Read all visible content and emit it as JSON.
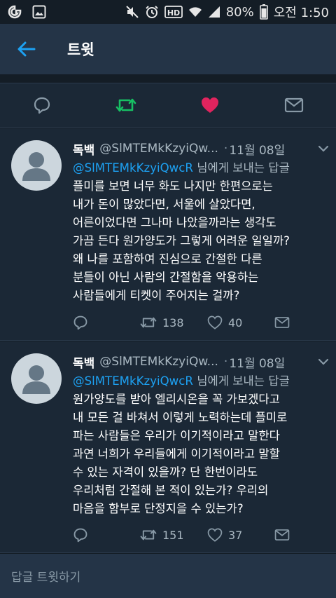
{
  "status_bar": {
    "battery_percent": "80%",
    "time": "오전 1:50",
    "hd_label": "HD"
  },
  "header": {
    "title": "트윗"
  },
  "colors": {
    "background": "#141d26",
    "header": "#243447",
    "card": "#1b2836",
    "accent": "#1da1f2",
    "retweet": "#17bf63",
    "like": "#e0245e",
    "muted": "#8899a6"
  },
  "tweets": [
    {
      "author_name": "독백",
      "author_handle": "@SlMTEMkKzyiQw...",
      "dot": "·",
      "date": "11월 08일",
      "mention": "@SlMTEMkKzyiQwcR",
      "reply_suffix": " 님에게 보내는 답글",
      "lines": [
        "플미를 보면 너무 화도 나지만 한편으로는",
        "내가 돈이 많았다면, 서울에 살았다면,",
        "어른이었다면 그나마 나았을까라는 생각도",
        "가끔 든다 원가양도가 그렇게 어려운 일일까?",
        "왜 나를 포함하여 진심으로 간절한 다른",
        "분들이 아닌 사람의 간절함을 악용하는",
        "사람들에게 티켓이 주어지는 걸까?"
      ],
      "retweets": "138",
      "likes": "40"
    },
    {
      "author_name": "독백",
      "author_handle": "@SlMTEMkKzyiQw...",
      "dot": "·",
      "date": "11월 08일",
      "mention": "@SlMTEMkKzyiQwcR",
      "reply_suffix": " 님에게 보내는 답글",
      "lines": [
        "원가양도를 받아 엘리시온을 꼭 가보겠다고",
        "내 모든 걸 바쳐서 이렇게 노력하는데 플미로",
        "파는 사람들은 우리가 이기적이라고 말한다",
        "과연 너희가 우리들에게 이기적이라고 말할",
        "수 있는 자격이 있을까? 단 한번이라도",
        "우리처럼 간절해 본 적이 있는가? 우리의",
        "마음을 함부로 단정지을 수 있는가?"
      ],
      "retweets": "151",
      "likes": "37"
    }
  ],
  "reply": {
    "placeholder": "답글 트윗하기"
  }
}
